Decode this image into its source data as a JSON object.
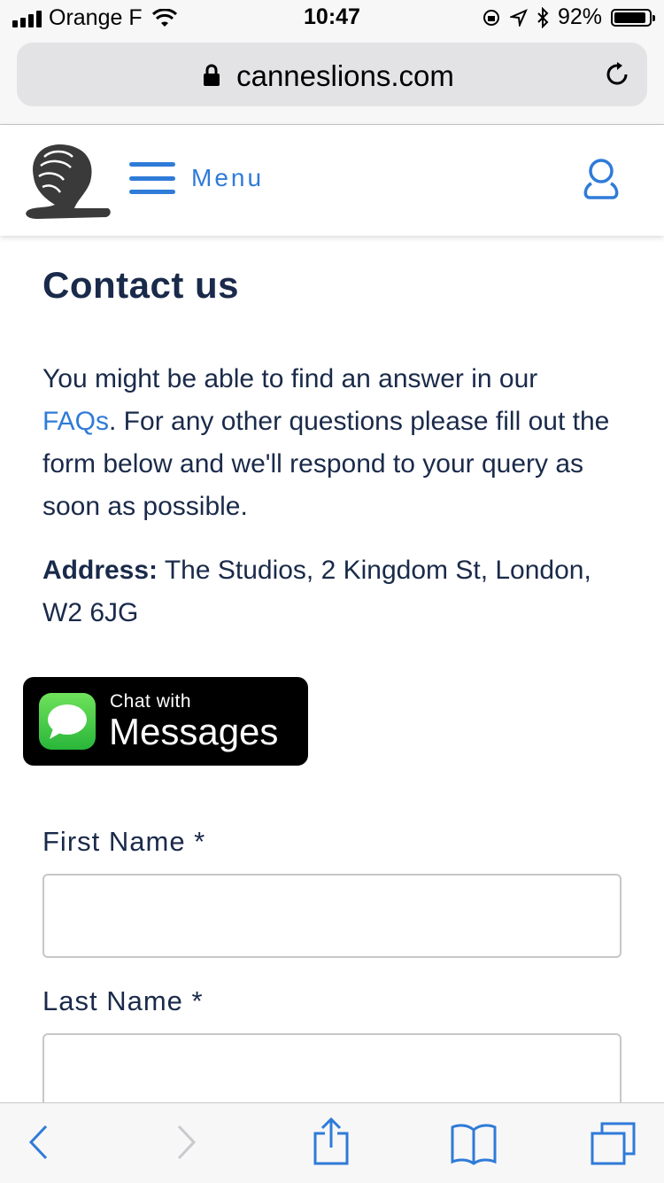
{
  "status_bar": {
    "carrier": "Orange F",
    "time": "10:47",
    "battery": "92%",
    "battery_level": 0.92
  },
  "browser": {
    "url": "canneslions.com"
  },
  "site_header": {
    "menu_label": "Menu"
  },
  "page": {
    "title": "Contact us",
    "intro_before_link": "You might be able to find an answer in our ",
    "faq_link": "FAQs",
    "intro_after_link": ". For any other questions please fill out the form below and we'll respond to your query as soon as possible.",
    "address_label": "Address:",
    "address_value": " The Studios, 2 Kingdom St, London, W2 6JG"
  },
  "chat_button": {
    "small_text": "Chat with",
    "big_text": "Messages"
  },
  "form": {
    "first_name_label": "First Name *",
    "first_name_value": "",
    "last_name_label": "Last Name *",
    "last_name_value": ""
  },
  "icons": {
    "status": [
      "signal-icon",
      "wifi-icon",
      "orientation-lock-icon",
      "location-icon",
      "bluetooth-icon",
      "battery-icon"
    ],
    "toolbar": [
      "back-icon",
      "forward-icon",
      "share-icon",
      "bookmarks-icon",
      "tabs-icon"
    ]
  },
  "colors": {
    "accent": "#2f7bd8",
    "text": "#1a2a4a",
    "messages_green": "#34c759"
  }
}
